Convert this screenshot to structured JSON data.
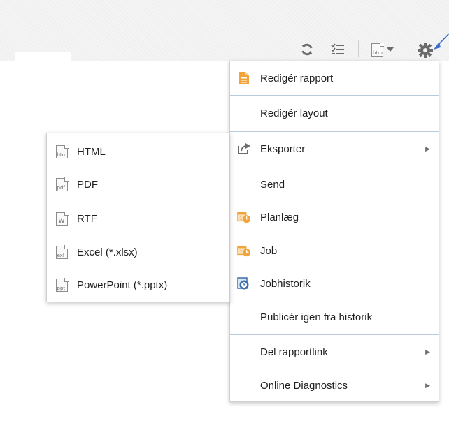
{
  "toolbar": {
    "icons": [
      "refresh-icon",
      "list-icon",
      "export-format-icon",
      "chevron-down-icon",
      "gear-icon"
    ],
    "export_icon_tag": "htm"
  },
  "menu": {
    "items": [
      {
        "label": "Redigér rapport",
        "icon": "edit-report-icon"
      },
      {
        "label": "Redigér layout",
        "icon": ""
      },
      {
        "label": "Eksporter",
        "icon": "export-icon",
        "submenu": true
      },
      {
        "label": "Send",
        "icon": ""
      },
      {
        "label": "Planlæg",
        "icon": "schedule-icon"
      },
      {
        "label": "Job",
        "icon": "job-icon"
      },
      {
        "label": "Jobhistorik",
        "icon": "job-history-icon"
      },
      {
        "label": "Publicér igen fra historik",
        "icon": ""
      },
      {
        "label": "Del rapportlink",
        "icon": "",
        "submenu": true
      },
      {
        "label": "Online Diagnostics",
        "icon": "",
        "submenu": true
      }
    ]
  },
  "submenu": {
    "items": [
      {
        "label": "HTML",
        "tag": "htm"
      },
      {
        "label": "PDF",
        "tag": "pdf"
      },
      {
        "label": "RTF",
        "tag": "W"
      },
      {
        "label": "Excel (*.xlsx)",
        "tag": "exl"
      },
      {
        "label": "PowerPoint (*.pptx)",
        "tag": "ppt"
      }
    ]
  },
  "colors": {
    "accent_orange": "#f2a33a",
    "separator": "#b9cadb",
    "cursor_blue": "#3c6fc9"
  }
}
